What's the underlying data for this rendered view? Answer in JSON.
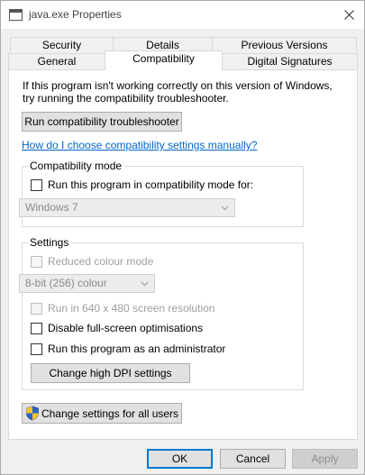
{
  "window": {
    "title": "java.exe Properties"
  },
  "tabs_row1": [
    {
      "label": "Security"
    },
    {
      "label": "Details"
    },
    {
      "label": "Previous Versions"
    }
  ],
  "tabs_row2": [
    {
      "label": "General"
    },
    {
      "label": "Compatibility"
    },
    {
      "label": "Digital Signatures"
    }
  ],
  "active_tab": "Compatibility",
  "panel": {
    "intro_line1": "If this program isn't working correctly on this version of Windows,",
    "intro_line2": "try running the compatibility troubleshooter.",
    "troubleshooter_button": "Run compatibility troubleshooter",
    "help_link": "How do I choose compatibility settings manually?",
    "compat_mode": {
      "title": "Compatibility mode",
      "checkbox_label": "Run this program in compatibility mode for:",
      "checked": false,
      "os_select_value": "Windows 7"
    },
    "settings": {
      "title": "Settings",
      "reduced_colour": {
        "label": "Reduced colour mode",
        "checked": false,
        "disabled": true
      },
      "colour_select_value": "8-bit (256) colour",
      "run_640": {
        "label": "Run in 640 x 480 screen resolution",
        "checked": false,
        "disabled": true
      },
      "disable_fullscreen": {
        "label": "Disable full-screen optimisations",
        "checked": false
      },
      "run_admin": {
        "label": "Run this program as an administrator",
        "checked": false
      },
      "dpi_button": "Change high DPI settings"
    },
    "all_users_button": "Change settings for all users"
  },
  "footer": {
    "ok": "OK",
    "cancel": "Cancel",
    "apply": "Apply"
  }
}
